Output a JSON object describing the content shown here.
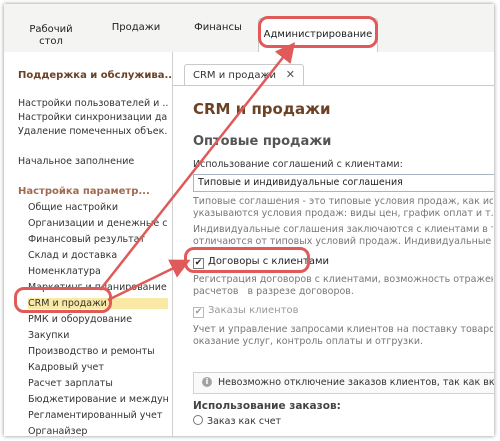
{
  "topnav": {
    "items": [
      {
        "label": "Рабочий\nстол"
      },
      {
        "label": "Продажи"
      },
      {
        "label": "Финансы"
      },
      {
        "label": "Администрирование"
      }
    ]
  },
  "sidebar": {
    "section1": "Поддержка и обслужива...",
    "links1": [
      "Настройки пользователей и ...",
      "Настройки синхронизации да...",
      "Удаление помеченных объек..."
    ],
    "initial": "Начальное заполнение",
    "section2": "Настройка параметр...",
    "items": [
      "Общие настройки",
      "Организации и денежные с...",
      "Финансовый результат",
      "Склад и доставка",
      "Номенклатура",
      "Маркетинг и планирование",
      "CRM и продажи",
      "РМК и оборудование",
      "Закупки",
      "Производство и ремонты",
      "Кадровый учет",
      "Расчет зарплаты",
      "Бюджетирование и междун...",
      "Регламентированный учет",
      "Органайзер"
    ]
  },
  "main": {
    "tab_label": "CRM и продажи",
    "tab_close": "✕",
    "title": "CRM и продажи",
    "subheading": "Оптовые продажи",
    "agreements_label": "Использование соглашений с клиентами:",
    "agreements_value": "Типовые и индивидуальные соглашения",
    "typical_hint": "Типовые соглашения - это типовые условия продаж, как испо\nуказываются условия продаж: виды цен, график оплат и т.д.",
    "individual_hint": "Индивидуальные соглашения заключаются с клиентами в том слу\nотличаются от типовых условий продаж. Индивидуальные соглаше",
    "contracts_check": "Договоры с клиентами",
    "contracts_checked": "✔",
    "contracts_hint": "Регистрация договоров с клиентами, возможность отражения\nрасчетов   в разрезе договоров.",
    "orders_check": "Заказы клиентов",
    "orders_checked": "✔",
    "requests_hint": "Учет и управление запросами клиентов на поставку товаров или\nоказание услуг, контроль оплаты и отгрузки.",
    "info_icon": "i",
    "info_text": "Невозможно отключение заказов клиентов, так как включе",
    "orders_usage": "Использование заказов:",
    "radio_label": "Заказ как счет"
  },
  "colors": {
    "accent_title": "#6b4226",
    "highlight": "#e05a5a",
    "selected": "#f9e9a4"
  }
}
